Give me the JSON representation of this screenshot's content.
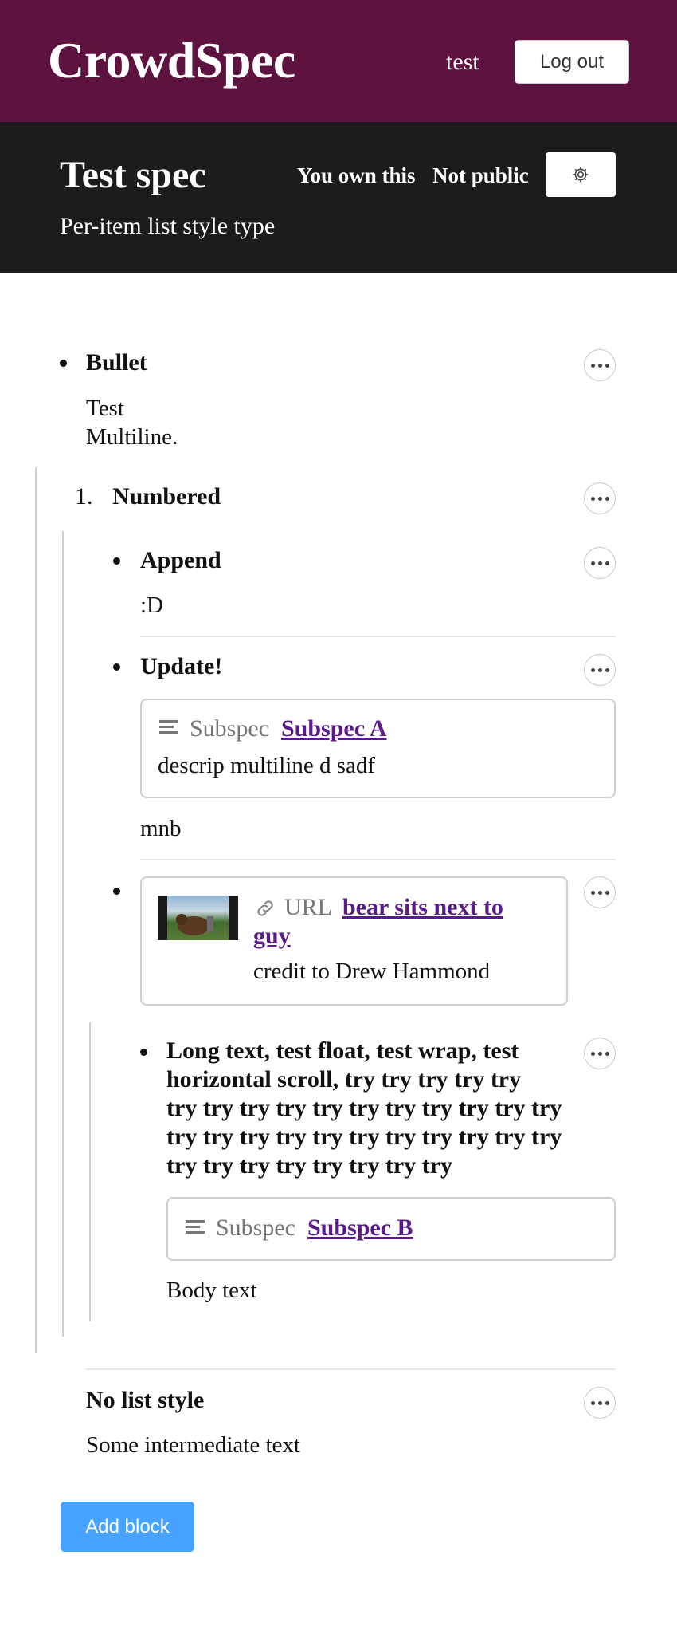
{
  "header": {
    "logo": "CrowdSpec",
    "username": "test",
    "logout_label": "Log out"
  },
  "spec": {
    "title": "Test spec",
    "ownership": "You own this",
    "visibility": "Not public",
    "description": "Per-item list style type",
    "settings_icon": "gear-icon"
  },
  "blocks": {
    "bullet": {
      "title": "Bullet",
      "body_line1": "Test",
      "body_line2": "Multiline."
    },
    "numbered": {
      "marker": "1.",
      "title": "Numbered"
    },
    "append": {
      "title": "Append",
      "body": ":D"
    },
    "update": {
      "title": "Update!",
      "subspec_label": "Subspec",
      "subspec_name": "Subspec A",
      "subspec_desc": "descrip multiline d sadf",
      "body": "mnb"
    },
    "url_block": {
      "url_label": "URL",
      "link_text_line1": "bear sits next to",
      "link_text_line2": "guy",
      "credit": "credit to Drew Hammond"
    },
    "long_text": {
      "title_lines": [
        "Long text, test float, test wrap, test",
        "horizontal scroll, try try try try try",
        "try try try try try try try try try try try",
        "try try try try try try try try try try try",
        "try try try try try try try try"
      ],
      "subspec_label": "Subspec",
      "subspec_name": "Subspec B",
      "body": "Body text"
    },
    "no_list_style": {
      "title": "No list style",
      "body": "Some intermediate text"
    }
  },
  "add_block_label": "Add block",
  "colors": {
    "topbar": "#5e1240",
    "spec_header": "#1c1c1e",
    "link": "#5a1a8a",
    "add_button": "#47a3ff"
  }
}
